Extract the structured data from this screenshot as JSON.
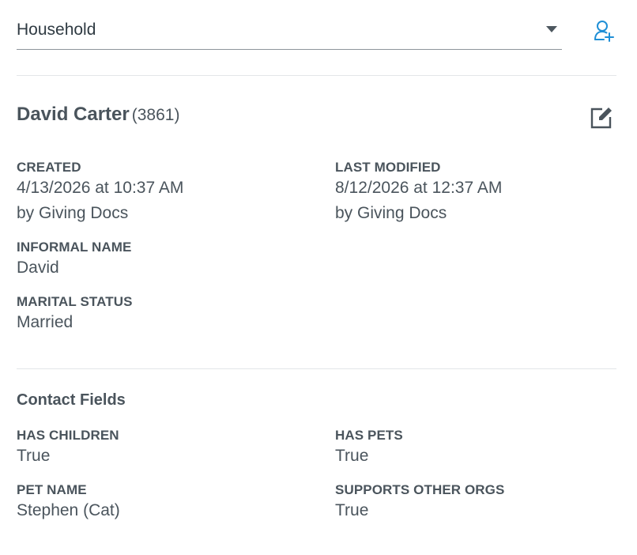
{
  "household_select": {
    "selected": "Household"
  },
  "contact": {
    "name": "David Carter",
    "id": "(3861)"
  },
  "record": {
    "created": {
      "label": "CREATED",
      "datetime": "4/13/2026 at 10:37 AM",
      "by": "by Giving Docs"
    },
    "last_modified": {
      "label": "LAST MODIFIED",
      "datetime": "8/12/2026 at 12:37 AM",
      "by": "by Giving Docs"
    },
    "informal_name": {
      "label": "INFORMAL NAME",
      "value": "David"
    },
    "marital_status": {
      "label": "MARITAL STATUS",
      "value": "Married"
    }
  },
  "contact_fields": {
    "title": "Contact Fields",
    "has_children": {
      "label": "HAS CHILDREN",
      "value": "True"
    },
    "has_pets": {
      "label": "HAS PETS",
      "value": "True"
    },
    "pet_name": {
      "label": "PET NAME",
      "value": "Stephen (Cat)"
    },
    "supports_other_orgs": {
      "label": "SUPPORTS OTHER ORGS",
      "value": "True"
    }
  },
  "icons": {
    "add_person": "add-person-icon",
    "edit": "edit-icon"
  },
  "colors": {
    "accent": "#1f8fd6",
    "text": "#4a545c",
    "divider": "#e3e6e8"
  }
}
